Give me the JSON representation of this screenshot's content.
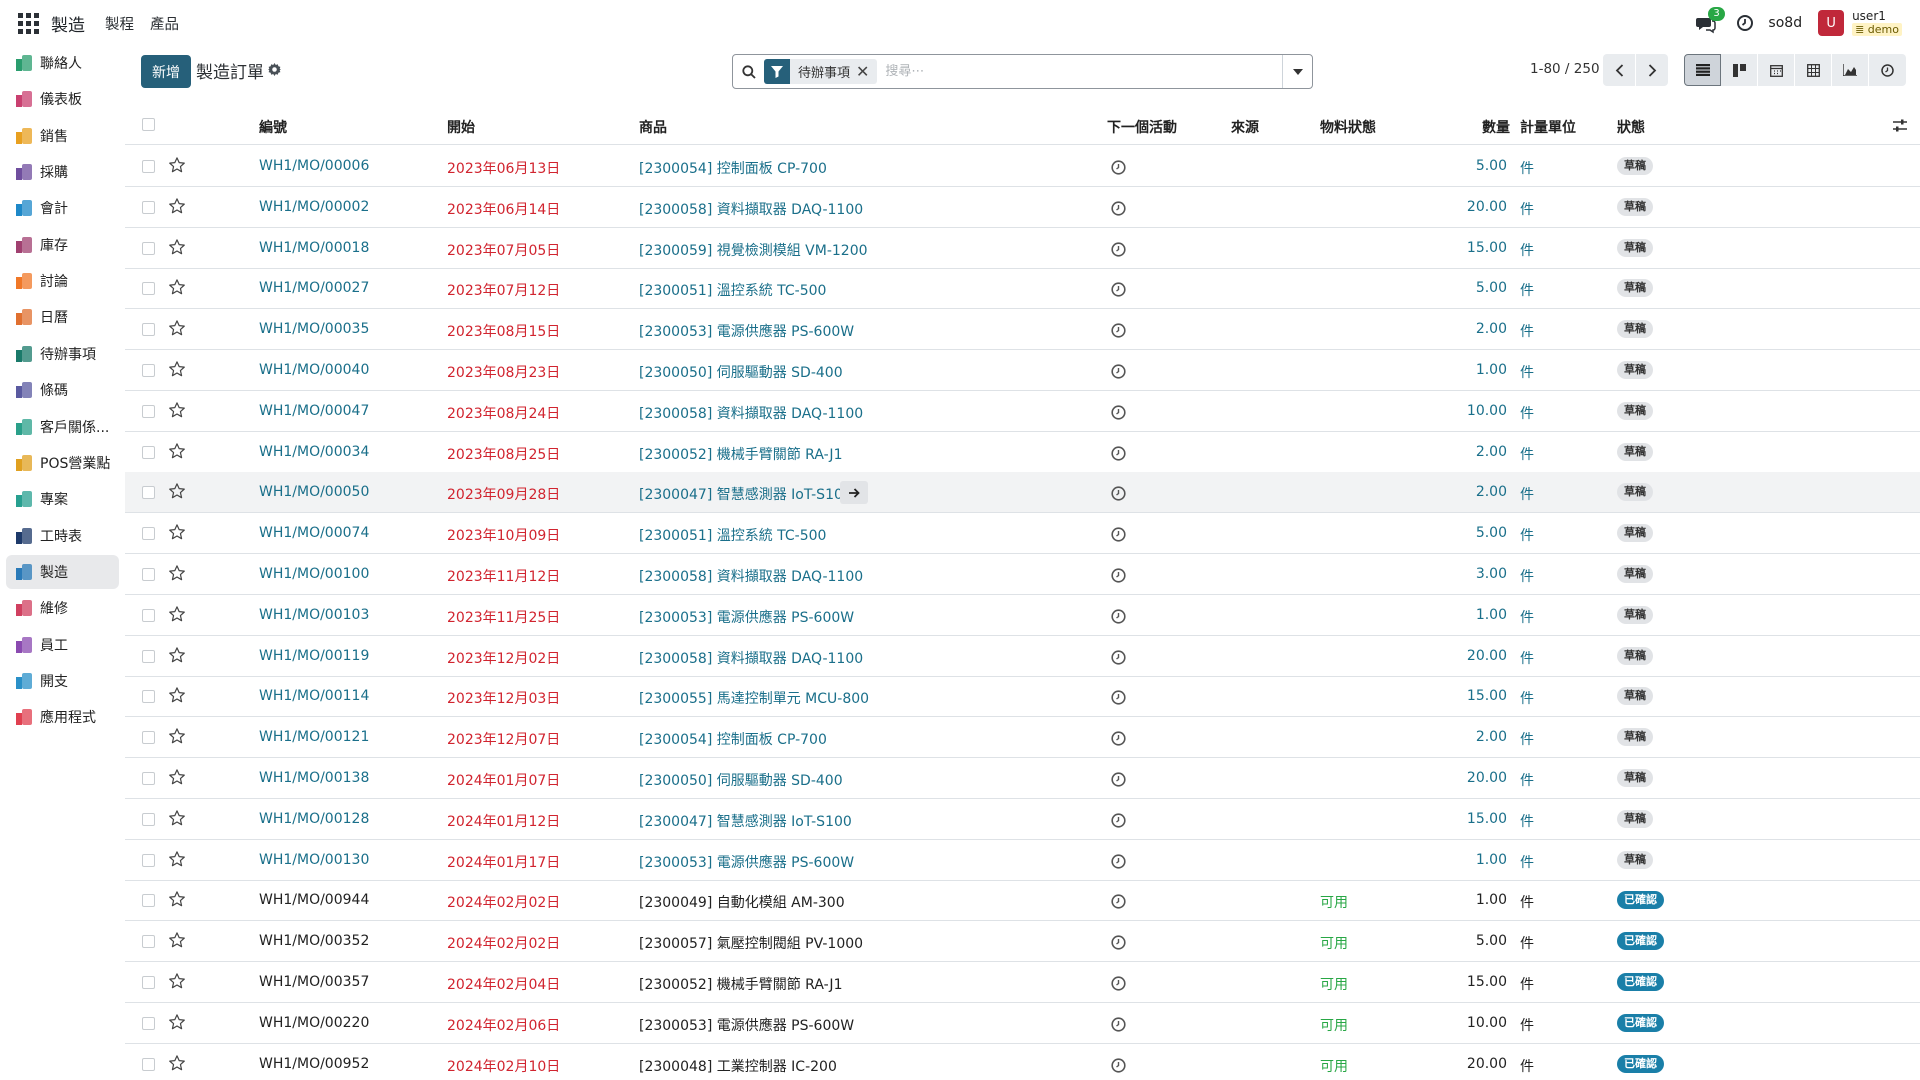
{
  "app": {
    "brand": "製造",
    "menu": [
      "製程",
      "產品"
    ]
  },
  "topbar": {
    "chat_count": "3",
    "company": "so8d",
    "avatar": "U",
    "username": "user1",
    "db": "demo"
  },
  "sidebar": [
    {
      "label": "聯絡人",
      "icon": "contacts-icon",
      "color": "#2a9d6e"
    },
    {
      "label": "儀表板",
      "icon": "dashboard-icon",
      "color": "#c94070"
    },
    {
      "label": "銷售",
      "icon": "sales-icon",
      "color": "#e8a020"
    },
    {
      "label": "採購",
      "icon": "purchase-icon",
      "color": "#6f4e9e"
    },
    {
      "label": "會計",
      "icon": "accounting-icon",
      "color": "#1e88c8"
    },
    {
      "label": "庫存",
      "icon": "inventory-icon",
      "color": "#a04070"
    },
    {
      "label": "討論",
      "icon": "discuss-icon",
      "color": "#f07828"
    },
    {
      "label": "日曆",
      "icon": "calendar-icon",
      "color": "#e07030"
    },
    {
      "label": "待辦事項",
      "icon": "todo-icon",
      "color": "#1a7a6a"
    },
    {
      "label": "條碼",
      "icon": "barcode-icon",
      "color": "#5a5aa0"
    },
    {
      "label": "客戶關係...",
      "icon": "crm-icon",
      "color": "#2aa08a"
    },
    {
      "label": "POS營業點",
      "icon": "pos-icon",
      "color": "#e0a020"
    },
    {
      "label": "專案",
      "icon": "project-icon",
      "color": "#28a090"
    },
    {
      "label": "工時表",
      "icon": "timesheet-icon",
      "color": "#1e3a6a"
    },
    {
      "label": "製造",
      "icon": "manufacturing-icon",
      "color": "#2a7ab8",
      "active": true
    },
    {
      "label": "維修",
      "icon": "repair-icon",
      "color": "#d04060"
    },
    {
      "label": "員工",
      "icon": "employees-icon",
      "color": "#8a4ab0"
    },
    {
      "label": "開支",
      "icon": "expenses-icon",
      "color": "#2a90c8"
    },
    {
      "label": "應用程式",
      "icon": "apps-icon",
      "color": "#e04050"
    }
  ],
  "control": {
    "new_label": "新增",
    "title": "製造訂單",
    "filter_facet": "待辦事項",
    "search_placeholder": "搜尋⋯",
    "pager": "1-80 / 250"
  },
  "columns": {
    "ref": "編號",
    "start": "開始",
    "product": "商品",
    "activity": "下一個活動",
    "source": "來源",
    "material": "物料狀態",
    "qty": "數量",
    "uom": "計量單位",
    "state": "狀態"
  },
  "rows": [
    {
      "ref": "WH1/MO/00006",
      "date": "2023年06月13日",
      "product": "[2300054] 控制面板 CP-700",
      "material": "",
      "qty": "5.00",
      "uom": "件",
      "state": "草稿",
      "kind": "draft"
    },
    {
      "ref": "WH1/MO/00002",
      "date": "2023年06月14日",
      "product": "[2300058] 資料擷取器 DAQ-1100",
      "material": "",
      "qty": "20.00",
      "uom": "件",
      "state": "草稿",
      "kind": "draft"
    },
    {
      "ref": "WH1/MO/00018",
      "date": "2023年07月05日",
      "product": "[2300059] 視覺檢測模組 VM-1200",
      "material": "",
      "qty": "15.00",
      "uom": "件",
      "state": "草稿",
      "kind": "draft"
    },
    {
      "ref": "WH1/MO/00027",
      "date": "2023年07月12日",
      "product": "[2300051] 溫控系統 TC-500",
      "material": "",
      "qty": "5.00",
      "uom": "件",
      "state": "草稿",
      "kind": "draft"
    },
    {
      "ref": "WH1/MO/00035",
      "date": "2023年08月15日",
      "product": "[2300053] 電源供應器 PS-600W",
      "material": "",
      "qty": "2.00",
      "uom": "件",
      "state": "草稿",
      "kind": "draft"
    },
    {
      "ref": "WH1/MO/00040",
      "date": "2023年08月23日",
      "product": "[2300050] 伺服驅動器 SD-400",
      "material": "",
      "qty": "1.00",
      "uom": "件",
      "state": "草稿",
      "kind": "draft"
    },
    {
      "ref": "WH1/MO/00047",
      "date": "2023年08月24日",
      "product": "[2300058] 資料擷取器 DAQ-1100",
      "material": "",
      "qty": "10.00",
      "uom": "件",
      "state": "草稿",
      "kind": "draft"
    },
    {
      "ref": "WH1/MO/00034",
      "date": "2023年08月25日",
      "product": "[2300052] 機械手臂關節 RA-J1",
      "material": "",
      "qty": "2.00",
      "uom": "件",
      "state": "草稿",
      "kind": "draft"
    },
    {
      "ref": "WH1/MO/00050",
      "date": "2023年09月28日",
      "product": "[2300047] 智慧感測器 IoT-S100",
      "material": "",
      "qty": "2.00",
      "uom": "件",
      "state": "草稿",
      "kind": "draft",
      "hover": true
    },
    {
      "ref": "WH1/MO/00074",
      "date": "2023年10月09日",
      "product": "[2300051] 溫控系統 TC-500",
      "material": "",
      "qty": "5.00",
      "uom": "件",
      "state": "草稿",
      "kind": "draft"
    },
    {
      "ref": "WH1/MO/00100",
      "date": "2023年11月12日",
      "product": "[2300058] 資料擷取器 DAQ-1100",
      "material": "",
      "qty": "3.00",
      "uom": "件",
      "state": "草稿",
      "kind": "draft"
    },
    {
      "ref": "WH1/MO/00103",
      "date": "2023年11月25日",
      "product": "[2300053] 電源供應器 PS-600W",
      "material": "",
      "qty": "1.00",
      "uom": "件",
      "state": "草稿",
      "kind": "draft"
    },
    {
      "ref": "WH1/MO/00119",
      "date": "2023年12月02日",
      "product": "[2300058] 資料擷取器 DAQ-1100",
      "material": "",
      "qty": "20.00",
      "uom": "件",
      "state": "草稿",
      "kind": "draft"
    },
    {
      "ref": "WH1/MO/00114",
      "date": "2023年12月03日",
      "product": "[2300055] 馬達控制單元 MCU-800",
      "material": "",
      "qty": "15.00",
      "uom": "件",
      "state": "草稿",
      "kind": "draft"
    },
    {
      "ref": "WH1/MO/00121",
      "date": "2023年12月07日",
      "product": "[2300054] 控制面板 CP-700",
      "material": "",
      "qty": "2.00",
      "uom": "件",
      "state": "草稿",
      "kind": "draft"
    },
    {
      "ref": "WH1/MO/00138",
      "date": "2024年01月07日",
      "product": "[2300050] 伺服驅動器 SD-400",
      "material": "",
      "qty": "20.00",
      "uom": "件",
      "state": "草稿",
      "kind": "draft"
    },
    {
      "ref": "WH1/MO/00128",
      "date": "2024年01月12日",
      "product": "[2300047] 智慧感測器 IoT-S100",
      "material": "",
      "qty": "15.00",
      "uom": "件",
      "state": "草稿",
      "kind": "draft"
    },
    {
      "ref": "WH1/MO/00130",
      "date": "2024年01月17日",
      "product": "[2300053] 電源供應器 PS-600W",
      "material": "",
      "qty": "1.00",
      "uom": "件",
      "state": "草稿",
      "kind": "draft"
    },
    {
      "ref": "WH1/MO/00944",
      "date": "2024年02月02日",
      "product": "[2300049] 自動化模組 AM-300",
      "material": "可用",
      "qty": "1.00",
      "uom": "件",
      "state": "已確認",
      "kind": "confirmed"
    },
    {
      "ref": "WH1/MO/00352",
      "date": "2024年02月02日",
      "product": "[2300057] 氣壓控制閥組 PV-1000",
      "material": "可用",
      "qty": "5.00",
      "uom": "件",
      "state": "已確認",
      "kind": "confirmed"
    },
    {
      "ref": "WH1/MO/00357",
      "date": "2024年02月04日",
      "product": "[2300052] 機械手臂關節 RA-J1",
      "material": "可用",
      "qty": "15.00",
      "uom": "件",
      "state": "已確認",
      "kind": "confirmed"
    },
    {
      "ref": "WH1/MO/00220",
      "date": "2024年02月06日",
      "product": "[2300053] 電源供應器 PS-600W",
      "material": "可用",
      "qty": "10.00",
      "uom": "件",
      "state": "已確認",
      "kind": "confirmed"
    },
    {
      "ref": "WH1/MO/00952",
      "date": "2024年02月10日",
      "product": "[2300048] 工業控制器 IC-200",
      "material": "可用",
      "qty": "20.00",
      "uom": "件",
      "state": "已確認",
      "kind": "confirmed"
    }
  ]
}
